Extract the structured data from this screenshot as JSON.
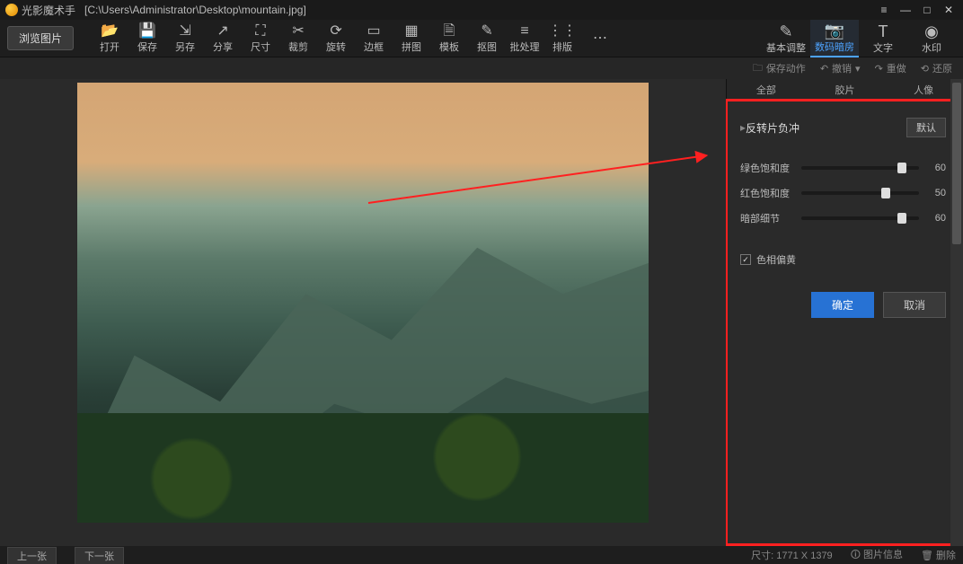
{
  "title": {
    "app": "光影魔术手",
    "path": "[C:\\Users\\Administrator\\Desktop\\mountain.jpg]"
  },
  "browse_label": "浏览图片",
  "toolbar": [
    {
      "icon": "📂",
      "label": "打开"
    },
    {
      "icon": "💾",
      "label": "保存"
    },
    {
      "icon": "⇲",
      "label": "另存"
    },
    {
      "icon": "↗",
      "label": "分享"
    },
    {
      "icon": "⛶",
      "label": "尺寸"
    },
    {
      "icon": "✂",
      "label": "裁剪"
    },
    {
      "icon": "⟳",
      "label": "旋转"
    },
    {
      "icon": "▭",
      "label": "边框"
    },
    {
      "icon": "▦",
      "label": "拼图"
    },
    {
      "icon": "🗎",
      "label": "模板"
    },
    {
      "icon": "✎",
      "label": "抠图"
    },
    {
      "icon": "≡",
      "label": "批处理"
    },
    {
      "icon": "⋮⋮",
      "label": "排版"
    },
    {
      "icon": "⋯",
      "label": ""
    }
  ],
  "mode_tabs": [
    {
      "icon": "✎",
      "label": "基本调整"
    },
    {
      "icon": "📷",
      "label": "数码暗房"
    },
    {
      "icon": "T",
      "label": "文字"
    },
    {
      "icon": "◉",
      "label": "水印"
    }
  ],
  "actionbar": {
    "save_action": "保存动作",
    "undo": "撤销",
    "redo": "重做",
    "restore": "还原"
  },
  "sub_tabs": [
    "全部",
    "胶片",
    "人像"
  ],
  "panel": {
    "section_title": "反转片负冲",
    "default_btn": "默认",
    "sliders": [
      {
        "label": "绿色饱和度",
        "value": 60,
        "pos": 82
      },
      {
        "label": "红色饱和度",
        "value": 50,
        "pos": 68
      },
      {
        "label": "暗部细节",
        "value": 60,
        "pos": 82
      }
    ],
    "checkbox_label": "色相偏黄",
    "ok": "确定",
    "cancel": "取消"
  },
  "status": {
    "prev": "上一张",
    "next": "下一张",
    "dims_label": "尺寸: 1771 X 1379",
    "info": "图片信息",
    "delete": "删除"
  }
}
